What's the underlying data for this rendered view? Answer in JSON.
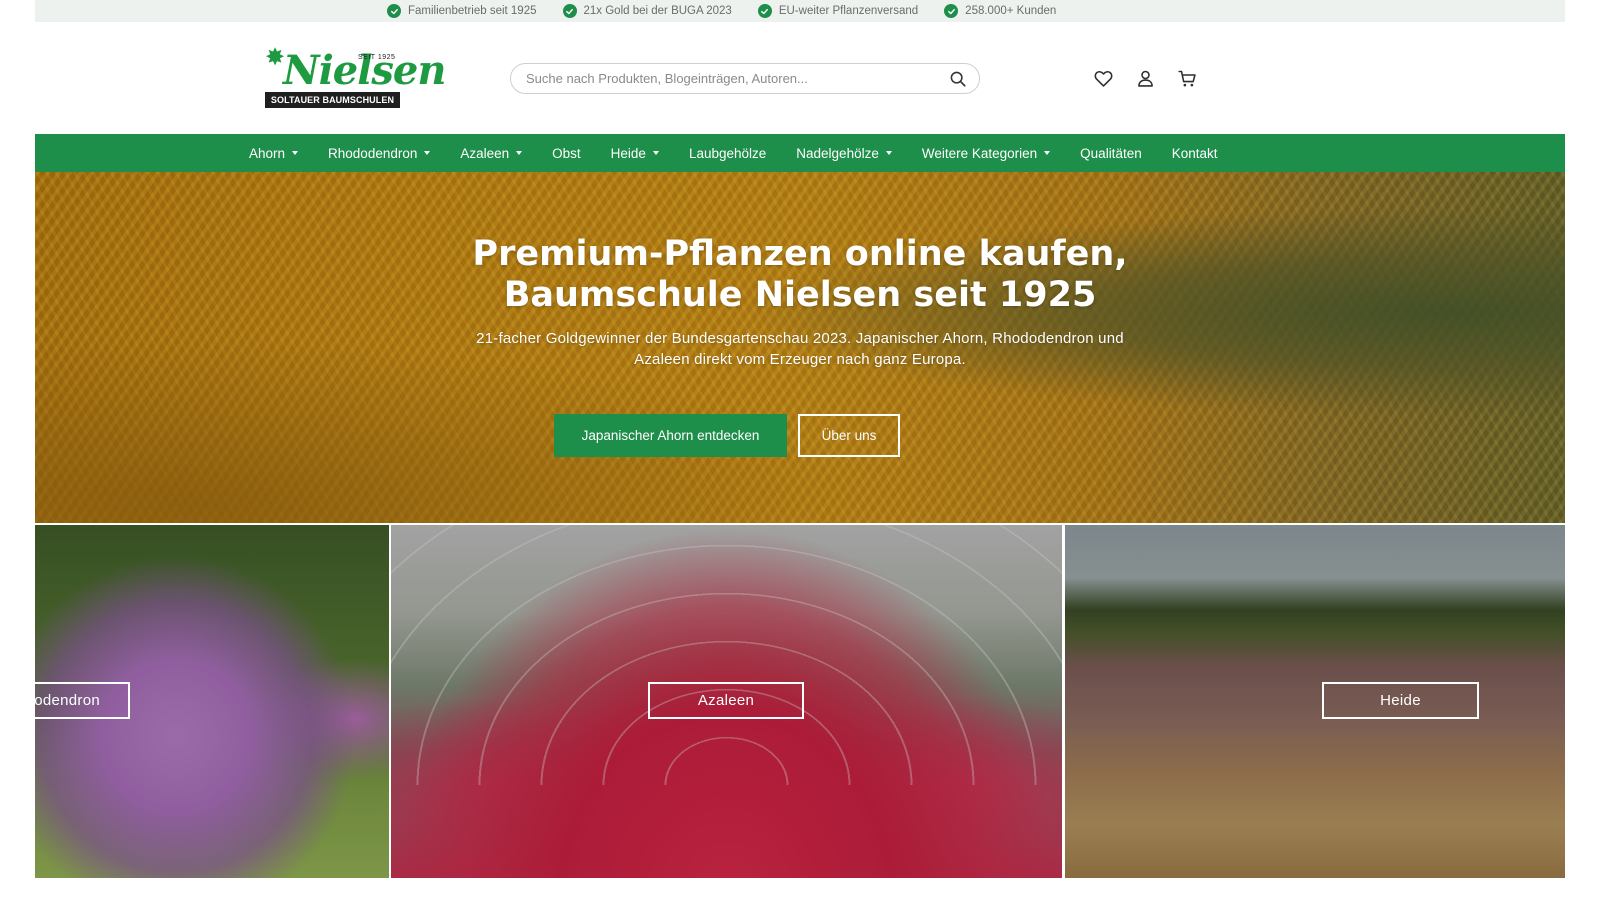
{
  "trustbar": {
    "items": [
      {
        "label": "Familienbetrieb seit 1925",
        "icon": "check-icon"
      },
      {
        "label": "21x Gold bei der BUGA 2023",
        "icon": "check-icon"
      },
      {
        "label": "EU-weiter Pflanzenversand",
        "icon": "check-icon"
      },
      {
        "label": "258.000+ Kunden",
        "icon": "check-icon"
      }
    ]
  },
  "header": {
    "logo": {
      "seit": "SEIT 1925",
      "name": "Nielsen",
      "sub": "SOLTAUER BAUMSCHULEN"
    },
    "search": {
      "placeholder": "Suche nach Produkten, Blogeinträgen, Autoren..."
    },
    "icons": [
      "heart-icon",
      "user-icon",
      "cart-icon"
    ]
  },
  "nav": {
    "items": [
      {
        "label": "Ahorn",
        "dropdown": true
      },
      {
        "label": "Rhododendron",
        "dropdown": true
      },
      {
        "label": "Azaleen",
        "dropdown": true
      },
      {
        "label": "Obst",
        "dropdown": false
      },
      {
        "label": "Heide",
        "dropdown": true
      },
      {
        "label": "Laubgehölze",
        "dropdown": false
      },
      {
        "label": "Nadelgehölze",
        "dropdown": true
      },
      {
        "label": "Weitere Kategorien",
        "dropdown": true
      },
      {
        "label": "Qualitäten",
        "dropdown": false
      },
      {
        "label": "Kontakt",
        "dropdown": false
      }
    ]
  },
  "hero": {
    "title_line1": "Premium-Pflanzen online kaufen,",
    "title_line2": "Baumschule Nielsen seit 1925",
    "subtitle": "21-facher Goldgewinner der Bundesgartenschau 2023. Japanischer Ahorn, Rhododendron und Azaleen direkt vom Erzeuger nach ganz Europa.",
    "primary_button": "Japanischer Ahorn entdecken",
    "secondary_button": "Über uns"
  },
  "tiles": [
    {
      "label": "Rhododendron"
    },
    {
      "label": "Azaleen"
    },
    {
      "label": "Heide"
    }
  ],
  "colors": {
    "brand_green": "#1e8f4b",
    "trustbar_bg": "#eef2ef"
  }
}
